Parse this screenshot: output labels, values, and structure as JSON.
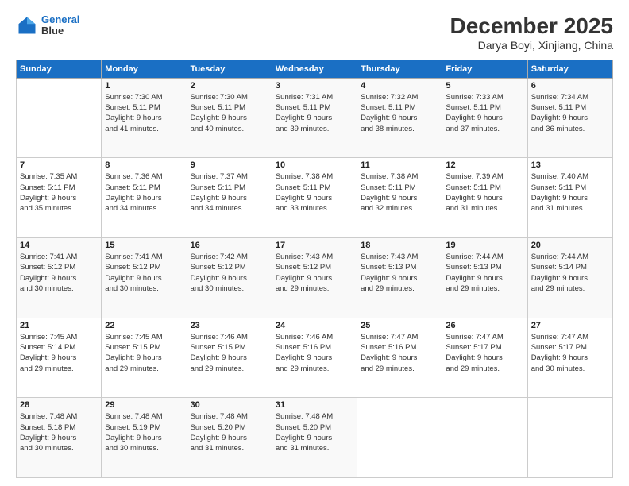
{
  "header": {
    "logo_line1": "General",
    "logo_line2": "Blue",
    "title": "December 2025",
    "subtitle": "Darya Boyi, Xinjiang, China"
  },
  "weekdays": [
    "Sunday",
    "Monday",
    "Tuesday",
    "Wednesday",
    "Thursday",
    "Friday",
    "Saturday"
  ],
  "weeks": [
    [
      {
        "day": "",
        "info": ""
      },
      {
        "day": "1",
        "info": "Sunrise: 7:30 AM\nSunset: 5:11 PM\nDaylight: 9 hours\nand 41 minutes."
      },
      {
        "day": "2",
        "info": "Sunrise: 7:30 AM\nSunset: 5:11 PM\nDaylight: 9 hours\nand 40 minutes."
      },
      {
        "day": "3",
        "info": "Sunrise: 7:31 AM\nSunset: 5:11 PM\nDaylight: 9 hours\nand 39 minutes."
      },
      {
        "day": "4",
        "info": "Sunrise: 7:32 AM\nSunset: 5:11 PM\nDaylight: 9 hours\nand 38 minutes."
      },
      {
        "day": "5",
        "info": "Sunrise: 7:33 AM\nSunset: 5:11 PM\nDaylight: 9 hours\nand 37 minutes."
      },
      {
        "day": "6",
        "info": "Sunrise: 7:34 AM\nSunset: 5:11 PM\nDaylight: 9 hours\nand 36 minutes."
      }
    ],
    [
      {
        "day": "7",
        "info": "Sunrise: 7:35 AM\nSunset: 5:11 PM\nDaylight: 9 hours\nand 35 minutes."
      },
      {
        "day": "8",
        "info": "Sunrise: 7:36 AM\nSunset: 5:11 PM\nDaylight: 9 hours\nand 34 minutes."
      },
      {
        "day": "9",
        "info": "Sunrise: 7:37 AM\nSunset: 5:11 PM\nDaylight: 9 hours\nand 34 minutes."
      },
      {
        "day": "10",
        "info": "Sunrise: 7:38 AM\nSunset: 5:11 PM\nDaylight: 9 hours\nand 33 minutes."
      },
      {
        "day": "11",
        "info": "Sunrise: 7:38 AM\nSunset: 5:11 PM\nDaylight: 9 hours\nand 32 minutes."
      },
      {
        "day": "12",
        "info": "Sunrise: 7:39 AM\nSunset: 5:11 PM\nDaylight: 9 hours\nand 31 minutes."
      },
      {
        "day": "13",
        "info": "Sunrise: 7:40 AM\nSunset: 5:11 PM\nDaylight: 9 hours\nand 31 minutes."
      }
    ],
    [
      {
        "day": "14",
        "info": "Sunrise: 7:41 AM\nSunset: 5:12 PM\nDaylight: 9 hours\nand 30 minutes."
      },
      {
        "day": "15",
        "info": "Sunrise: 7:41 AM\nSunset: 5:12 PM\nDaylight: 9 hours\nand 30 minutes."
      },
      {
        "day": "16",
        "info": "Sunrise: 7:42 AM\nSunset: 5:12 PM\nDaylight: 9 hours\nand 30 minutes."
      },
      {
        "day": "17",
        "info": "Sunrise: 7:43 AM\nSunset: 5:12 PM\nDaylight: 9 hours\nand 29 minutes."
      },
      {
        "day": "18",
        "info": "Sunrise: 7:43 AM\nSunset: 5:13 PM\nDaylight: 9 hours\nand 29 minutes."
      },
      {
        "day": "19",
        "info": "Sunrise: 7:44 AM\nSunset: 5:13 PM\nDaylight: 9 hours\nand 29 minutes."
      },
      {
        "day": "20",
        "info": "Sunrise: 7:44 AM\nSunset: 5:14 PM\nDaylight: 9 hours\nand 29 minutes."
      }
    ],
    [
      {
        "day": "21",
        "info": "Sunrise: 7:45 AM\nSunset: 5:14 PM\nDaylight: 9 hours\nand 29 minutes."
      },
      {
        "day": "22",
        "info": "Sunrise: 7:45 AM\nSunset: 5:15 PM\nDaylight: 9 hours\nand 29 minutes."
      },
      {
        "day": "23",
        "info": "Sunrise: 7:46 AM\nSunset: 5:15 PM\nDaylight: 9 hours\nand 29 minutes."
      },
      {
        "day": "24",
        "info": "Sunrise: 7:46 AM\nSunset: 5:16 PM\nDaylight: 9 hours\nand 29 minutes."
      },
      {
        "day": "25",
        "info": "Sunrise: 7:47 AM\nSunset: 5:16 PM\nDaylight: 9 hours\nand 29 minutes."
      },
      {
        "day": "26",
        "info": "Sunrise: 7:47 AM\nSunset: 5:17 PM\nDaylight: 9 hours\nand 29 minutes."
      },
      {
        "day": "27",
        "info": "Sunrise: 7:47 AM\nSunset: 5:17 PM\nDaylight: 9 hours\nand 30 minutes."
      }
    ],
    [
      {
        "day": "28",
        "info": "Sunrise: 7:48 AM\nSunset: 5:18 PM\nDaylight: 9 hours\nand 30 minutes."
      },
      {
        "day": "29",
        "info": "Sunrise: 7:48 AM\nSunset: 5:19 PM\nDaylight: 9 hours\nand 30 minutes."
      },
      {
        "day": "30",
        "info": "Sunrise: 7:48 AM\nSunset: 5:20 PM\nDaylight: 9 hours\nand 31 minutes."
      },
      {
        "day": "31",
        "info": "Sunrise: 7:48 AM\nSunset: 5:20 PM\nDaylight: 9 hours\nand 31 minutes."
      },
      {
        "day": "",
        "info": ""
      },
      {
        "day": "",
        "info": ""
      },
      {
        "day": "",
        "info": ""
      }
    ]
  ]
}
